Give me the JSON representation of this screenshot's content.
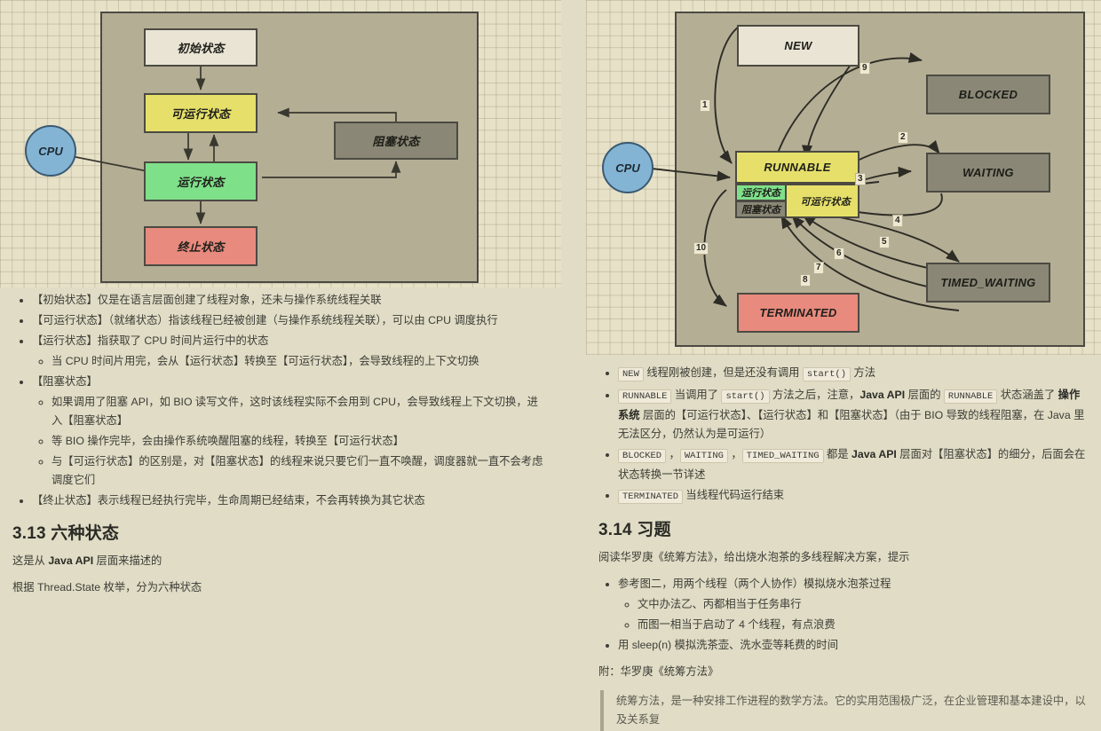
{
  "left": {
    "diagram": {
      "cpu_label": "CPU",
      "nodes": [
        {
          "id": "init",
          "label": "初始状态"
        },
        {
          "id": "runnable",
          "label": "可运行状态"
        },
        {
          "id": "running",
          "label": "运行状态"
        },
        {
          "id": "terminated",
          "label": "终止状态"
        },
        {
          "id": "blocked",
          "label": "阻塞状态"
        }
      ]
    },
    "bullets": [
      {
        "text": "【初始状态】仅是在语言层面创建了线程对象，还未与操作系统线程关联",
        "children": []
      },
      {
        "text": "【可运行状态】（就绪状态）指该线程已经被创建（与操作系统线程关联），可以由 CPU 调度执行",
        "children": []
      },
      {
        "text": "【运行状态】指获取了 CPU 时间片运行中的状态",
        "children": [
          "当 CPU 时间片用完，会从【运行状态】转换至【可运行状态】，会导致线程的上下文切换"
        ]
      },
      {
        "text": "【阻塞状态】",
        "children": [
          "如果调用了阻塞 API，如 BIO 读写文件，这时该线程实际不会用到 CPU，会导致线程上下文切换，进入【阻塞状态】",
          "等 BIO 操作完毕，会由操作系统唤醒阻塞的线程，转换至【可运行状态】",
          "与【可运行状态】的区别是，对【阻塞状态】的线程来说只要它们一直不唤醒，调度器就一直不会考虑调度它们"
        ]
      },
      {
        "text": "【终止状态】表示线程已经执行完毕，生命周期已经结束，不会再转换为其它状态",
        "children": []
      }
    ],
    "section": {
      "heading": "3.13 六种状态",
      "para1_a": "这是从 ",
      "para1_b": "Java API",
      "para1_c": " 层面来描述的",
      "para2": "根据 Thread.State 枚举，分为六种状态"
    }
  },
  "right": {
    "diagram": {
      "cpu_label": "CPU",
      "nodes": [
        {
          "id": "new",
          "label": "NEW"
        },
        {
          "id": "blocked",
          "label": "BLOCKED"
        },
        {
          "id": "runnable",
          "label": "RUNNABLE"
        },
        {
          "id": "waiting",
          "label": "WAITING"
        },
        {
          "id": "timed_waiting",
          "label": "TIMED_WAITING"
        },
        {
          "id": "terminated",
          "label": "TERMINATED"
        }
      ],
      "sub_nodes": [
        {
          "id": "running_cn",
          "label": "运行状态"
        },
        {
          "id": "blocked_cn",
          "label": "阻塞状态"
        },
        {
          "id": "runnable_cn",
          "label": "可运行状态"
        }
      ],
      "edge_labels": [
        "1",
        "2",
        "3",
        "4",
        "5",
        "6",
        "7",
        "8",
        "9",
        "10"
      ]
    },
    "bullets": [
      {
        "parts": [
          {
            "t": "code",
            "v": "NEW"
          },
          {
            "t": "text",
            "v": " 线程刚被创建，但是还没有调用 "
          },
          {
            "t": "code",
            "v": "start()"
          },
          {
            "t": "text",
            "v": " 方法"
          }
        ]
      },
      {
        "parts": [
          {
            "t": "code",
            "v": "RUNNABLE"
          },
          {
            "t": "text",
            "v": " 当调用了 "
          },
          {
            "t": "code",
            "v": "start()"
          },
          {
            "t": "text",
            "v": " 方法之后，注意，"
          },
          {
            "t": "bold",
            "v": "Java API"
          },
          {
            "t": "text",
            "v": " 层面的 "
          },
          {
            "t": "code",
            "v": "RUNNABLE"
          },
          {
            "t": "text",
            "v": " 状态涵盖了 "
          },
          {
            "t": "bold",
            "v": "操作系统"
          },
          {
            "t": "text",
            "v": " 层面的【可运行状态】、【运行状态】和【阻塞状态】（由于 BIO 导致的线程阻塞，在 Java 里无法区分，仍然认为是可运行）"
          }
        ]
      },
      {
        "parts": [
          {
            "t": "code",
            "v": "BLOCKED"
          },
          {
            "t": "text",
            "v": " ，"
          },
          {
            "t": "code",
            "v": "WAITING"
          },
          {
            "t": "text",
            "v": " ，"
          },
          {
            "t": "code",
            "v": "TIMED_WAITING"
          },
          {
            "t": "text",
            "v": " 都是 "
          },
          {
            "t": "bold",
            "v": "Java API"
          },
          {
            "t": "text",
            "v": " 层面对【阻塞状态】的细分，后面会在状态转换一节详述"
          }
        ]
      },
      {
        "parts": [
          {
            "t": "code",
            "v": "TERMINATED"
          },
          {
            "t": "text",
            "v": " 当线程代码运行结束"
          }
        ]
      }
    ],
    "section": {
      "heading": "3.14 习题",
      "intro": "阅读华罗庚《统筹方法》，给出烧水泡茶的多线程解决方案，提示",
      "bullets": [
        {
          "text": "参考图二，用两个线程（两个人协作）模拟烧水泡茶过程",
          "children": [
            "文中办法乙、丙都相当于任务串行",
            "而图一相当于启动了 4 个线程，有点浪费"
          ]
        },
        {
          "text": "用 sleep(n) 模拟洗茶壶、洗水壶等耗费的时间",
          "children": []
        }
      ],
      "attach": "附：华罗庚《统筹方法》",
      "quote": "统筹方法，是一种安排工作进程的数学方法。它的实用范围极广泛，在企业管理和基本建设中，以及关系复"
    }
  },
  "colors": {
    "page_bg": "#e0dcc5",
    "panel_bg": "#b4ae95",
    "grid_bg": "#e7e1c8",
    "new_box": "#e9e4d4",
    "yellow_box": "#e6e06a",
    "green_box": "#7fe08a",
    "red_box": "#e88a7d",
    "gray_box": "#8a8776",
    "cpu_blue": "#84b4d4",
    "stroke": "#4b4a42"
  }
}
